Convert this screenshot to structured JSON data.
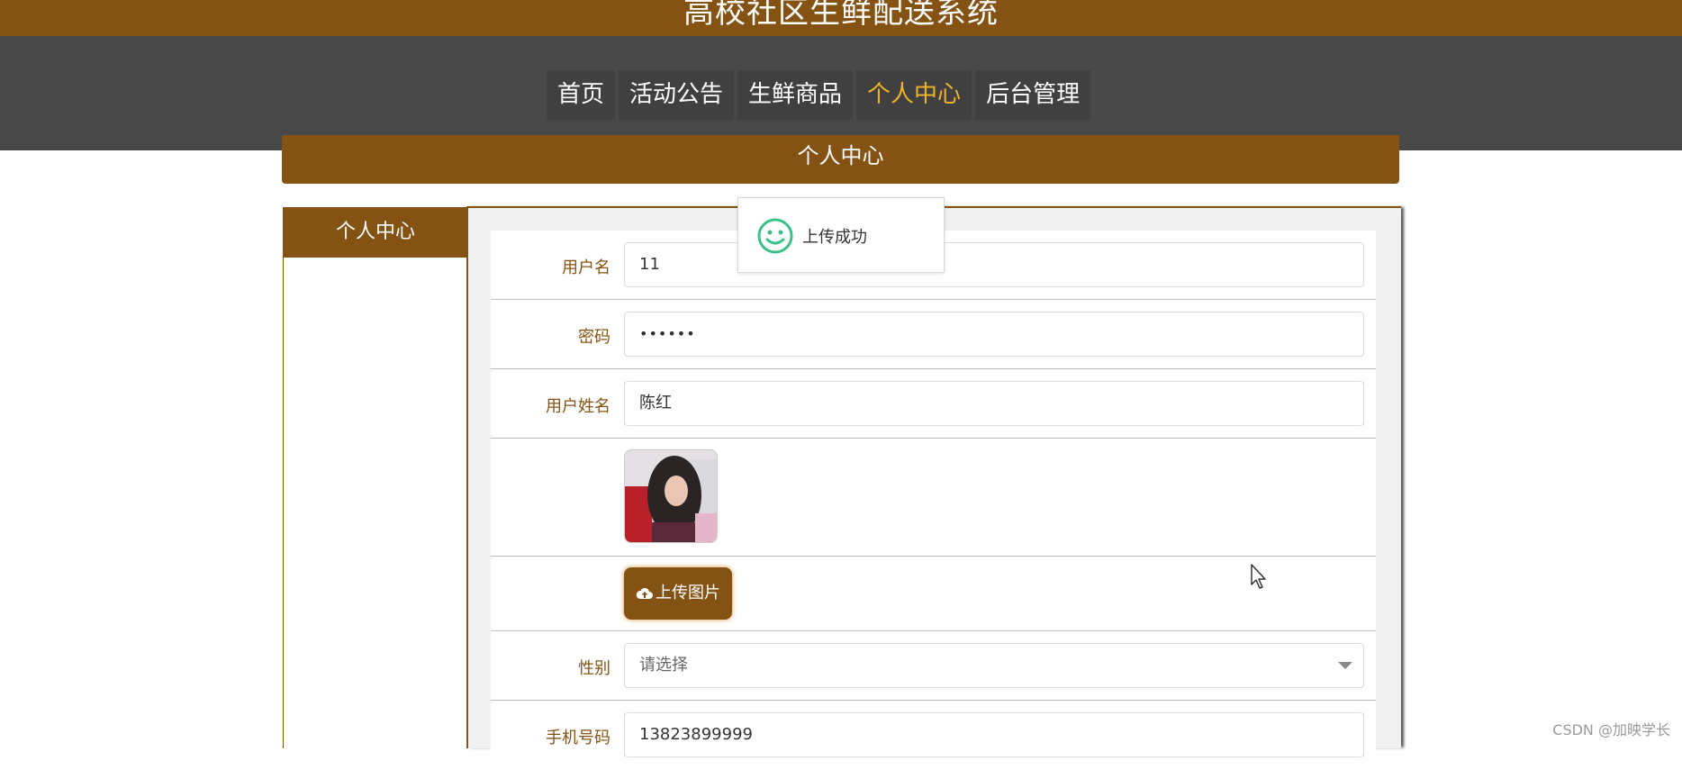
{
  "header": {
    "site_title": "高校社区生鲜配送系统"
  },
  "nav": {
    "items": [
      {
        "label": "首页",
        "active": false
      },
      {
        "label": "活动公告",
        "active": false
      },
      {
        "label": "生鲜商品",
        "active": false
      },
      {
        "label": "个人中心",
        "active": true
      },
      {
        "label": "后台管理",
        "active": false
      }
    ],
    "active_color": "#f0b429"
  },
  "banner": {
    "title": "个人中心"
  },
  "sidebar": {
    "header": "个人中心"
  },
  "form": {
    "username": {
      "label": "用户名",
      "value": "11"
    },
    "password": {
      "label": "密码",
      "value": "••••••"
    },
    "fullname": {
      "label": "用户姓名",
      "value": "陈红"
    },
    "upload_button": {
      "label": "上传图片",
      "icon": "cloud-upload-icon"
    },
    "gender": {
      "label": "性别",
      "placeholder": "请选择"
    },
    "phone": {
      "label": "手机号码",
      "value": "13823899999"
    }
  },
  "toast": {
    "message": "上传成功",
    "icon": "smile-icon",
    "icon_color": "#3cc08a"
  },
  "watermark": "CSDN @加映学长",
  "colors": {
    "brand": "#845314",
    "nav_bg": "#484848",
    "panel_bg": "#f1f1f1"
  }
}
